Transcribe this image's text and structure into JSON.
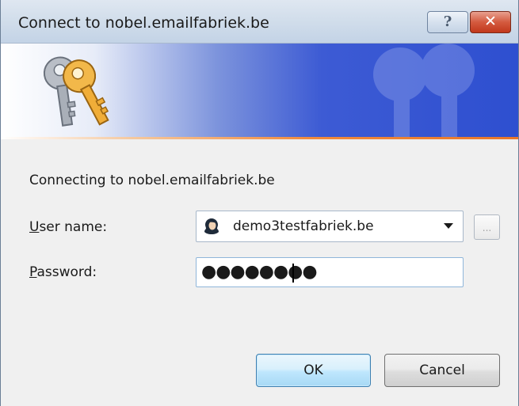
{
  "window": {
    "title": "Connect to nobel.emailfabriek.be",
    "help_label": "?",
    "close_label": "✕"
  },
  "banner": {
    "icon": "keys-icon"
  },
  "content": {
    "connecting_text": "Connecting to nobel.emailfabriek.be",
    "username": {
      "label_accel": "U",
      "label_rest": "ser name:",
      "value": "demo3testfabriek.be",
      "icon": "user-icon"
    },
    "browse_label": "...",
    "password": {
      "label_accel": "P",
      "label_rest": "assword:",
      "value": "●●●●●●●●"
    }
  },
  "buttons": {
    "ok_label": "OK",
    "cancel_label": "Cancel"
  },
  "colors": {
    "banner_blue": "#2e4fd0",
    "accent_orange": "#e8772a",
    "close_red": "#c1381c"
  }
}
